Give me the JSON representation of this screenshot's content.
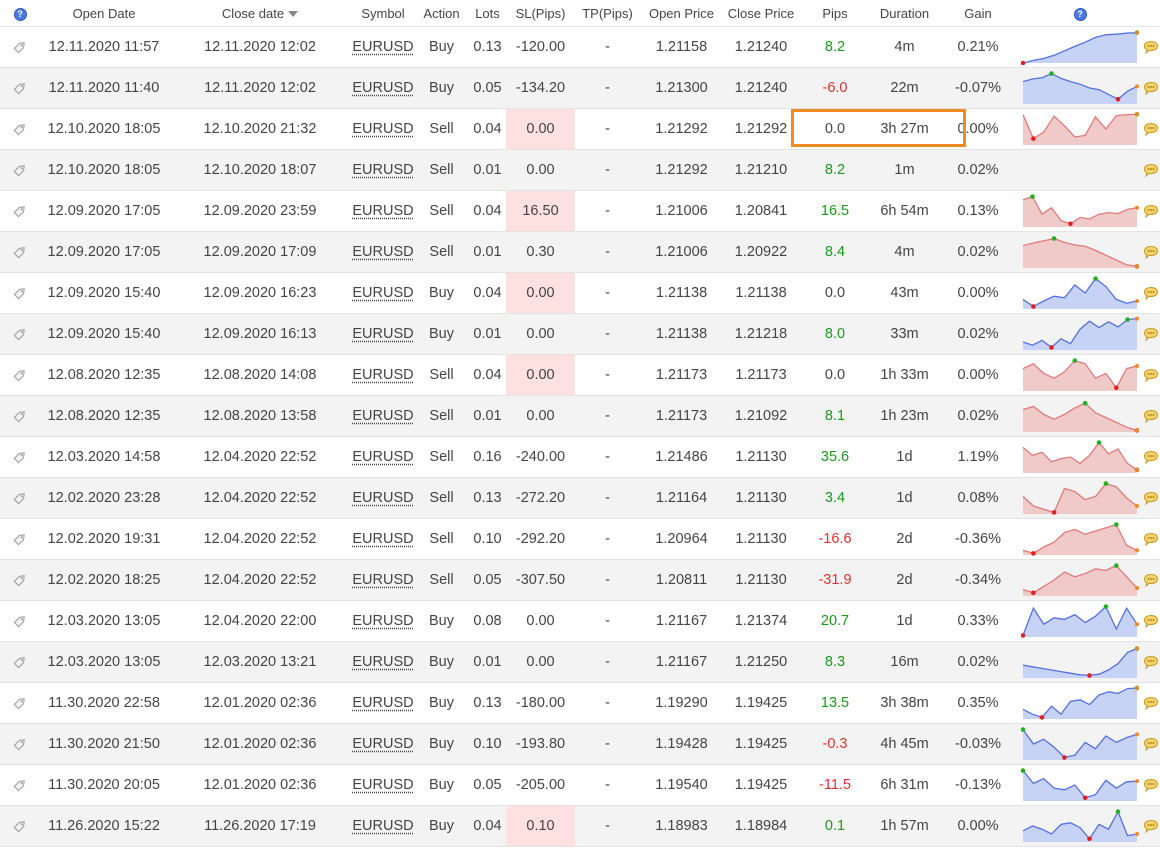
{
  "header": {
    "open_date": "Open Date",
    "close_date": "Close date",
    "symbol": "Symbol",
    "action": "Action",
    "lots": "Lots",
    "sl": "SL(Pips)",
    "tp": "TP(Pips)",
    "open_price": "Open Price",
    "close_price": "Close Price",
    "pips": "Pips",
    "duration": "Duration",
    "gain": "Gain",
    "help_glyph": "?"
  },
  "colors": {
    "buy_fill": "#c6d3f7",
    "buy_line": "#5570e0",
    "sell_fill": "#f0c9c9",
    "sell_line": "#e07a7a",
    "high_marker": "#22b022",
    "low_marker": "#e02020",
    "end_marker": "#f08a24",
    "highlight": "#f08a24"
  },
  "icons": {
    "row_tag": "tag-icon",
    "row_note": "comment-bubble-icon"
  },
  "rows": [
    {
      "open": "12.11.2020 11:57",
      "close": "12.11.2020 12:02",
      "symbol": "EURUSD",
      "action": "Buy",
      "lots": "0.13",
      "sl": "-120.00",
      "sl_pink": false,
      "tp": "-",
      "open_price": "1.21158",
      "close_price": "1.21240",
      "pips": "8.2",
      "duration": "4m",
      "gain": "0.21%",
      "spark": [
        0,
        8,
        14,
        24,
        38,
        52,
        65,
        80,
        88,
        90,
        93,
        95
      ],
      "spark_hi": 11,
      "spark_lo": 0
    },
    {
      "open": "12.11.2020 11:40",
      "close": "12.11.2020 12:02",
      "symbol": "EURUSD",
      "action": "Buy",
      "lots": "0.05",
      "sl": "-134.20",
      "sl_pink": false,
      "tp": "-",
      "open_price": "1.21300",
      "close_price": "1.21240",
      "pips": "-6.0",
      "duration": "22m",
      "gain": "-0.07%",
      "spark": [
        70,
        78,
        82,
        95,
        80,
        70,
        62,
        50,
        45,
        30,
        15,
        40,
        55
      ],
      "spark_hi": 3,
      "spark_lo": 10
    },
    {
      "open": "12.10.2020 18:05",
      "close": "12.10.2020 21:32",
      "symbol": "EURUSD",
      "action": "Sell",
      "lots": "0.04",
      "sl": "0.00",
      "sl_pink": true,
      "tp": "-",
      "open_price": "1.21292",
      "close_price": "1.21292",
      "pips": "0.0",
      "duration": "3h 27m",
      "gain": "0.00%",
      "spark": [
        95,
        20,
        40,
        90,
        60,
        25,
        30,
        88,
        50,
        92,
        95,
        96
      ],
      "spark_hi": 11,
      "spark_lo": 1
    },
    {
      "open": "12.10.2020 18:05",
      "close": "12.10.2020 18:07",
      "symbol": "EURUSD",
      "action": "Sell",
      "lots": "0.01",
      "sl": "0.00",
      "sl_pink": false,
      "tp": "-",
      "open_price": "1.21292",
      "close_price": "1.21210",
      "pips": "8.2",
      "duration": "1m",
      "gain": "0.02%",
      "spark": [],
      "spark_hi": -1,
      "spark_lo": -1
    },
    {
      "open": "12.09.2020 17:05",
      "close": "12.09.2020 23:59",
      "symbol": "EURUSD",
      "action": "Sell",
      "lots": "0.04",
      "sl": "16.50",
      "sl_pink": true,
      "tp": "-",
      "open_price": "1.21006",
      "close_price": "1.20841",
      "pips": "16.5",
      "duration": "6h 54m",
      "gain": "0.13%",
      "spark": [
        85,
        95,
        40,
        60,
        20,
        10,
        30,
        25,
        40,
        45,
        42,
        55,
        60
      ],
      "spark_hi": 1,
      "spark_lo": 5
    },
    {
      "open": "12.09.2020 17:05",
      "close": "12.09.2020 17:09",
      "symbol": "EURUSD",
      "action": "Sell",
      "lots": "0.01",
      "sl": "0.30",
      "sl_pink": false,
      "tp": "-",
      "open_price": "1.21006",
      "close_price": "1.20922",
      "pips": "8.4",
      "duration": "4m",
      "gain": "0.02%",
      "spark": [
        70,
        78,
        85,
        92,
        80,
        72,
        68,
        55,
        40,
        25,
        10,
        5
      ],
      "spark_hi": 3,
      "spark_lo": 11
    },
    {
      "open": "12.09.2020 15:40",
      "close": "12.09.2020 16:23",
      "symbol": "EURUSD",
      "action": "Buy",
      "lots": "0.04",
      "sl": "0.00",
      "sl_pink": true,
      "tp": "-",
      "open_price": "1.21138",
      "close_price": "1.21138",
      "pips": "0.0",
      "duration": "43m",
      "gain": "0.00%",
      "spark": [
        30,
        8,
        25,
        40,
        35,
        75,
        50,
        95,
        70,
        30,
        18,
        25
      ],
      "spark_hi": 7,
      "spark_lo": 1
    },
    {
      "open": "12.09.2020 15:40",
      "close": "12.09.2020 16:13",
      "symbol": "EURUSD",
      "action": "Buy",
      "lots": "0.01",
      "sl": "0.00",
      "sl_pink": false,
      "tp": "-",
      "open_price": "1.21138",
      "close_price": "1.21218",
      "pips": "8.0",
      "duration": "33m",
      "gain": "0.02%",
      "spark": [
        25,
        15,
        30,
        8,
        35,
        20,
        65,
        90,
        70,
        88,
        72,
        95,
        98
      ],
      "spark_hi": 11,
      "spark_lo": 3
    },
    {
      "open": "12.08.2020 12:35",
      "close": "12.08.2020 14:08",
      "symbol": "EURUSD",
      "action": "Sell",
      "lots": "0.04",
      "sl": "0.00",
      "sl_pink": true,
      "tp": "-",
      "open_price": "1.21173",
      "close_price": "1.21173",
      "pips": "0.0",
      "duration": "1h 33m",
      "gain": "0.00%",
      "spark": [
        70,
        85,
        55,
        40,
        60,
        95,
        85,
        40,
        55,
        10,
        70,
        78
      ],
      "spark_hi": 5,
      "spark_lo": 9
    },
    {
      "open": "12.08.2020 12:35",
      "close": "12.08.2020 13:58",
      "symbol": "EURUSD",
      "action": "Sell",
      "lots": "0.01",
      "sl": "0.00",
      "sl_pink": false,
      "tp": "-",
      "open_price": "1.21173",
      "close_price": "1.21092",
      "pips": "8.1",
      "duration": "1h 23m",
      "gain": "0.02%",
      "spark": [
        70,
        80,
        55,
        40,
        55,
        75,
        90,
        60,
        45,
        30,
        15,
        5
      ],
      "spark_hi": 6,
      "spark_lo": 11
    },
    {
      "open": "12.03.2020 14:58",
      "close": "12.04.2020 22:52",
      "symbol": "EURUSD",
      "action": "Sell",
      "lots": "0.16",
      "sl": "-240.00",
      "sl_pink": false,
      "tp": "-",
      "open_price": "1.21486",
      "close_price": "1.21130",
      "pips": "35.6",
      "duration": "1d",
      "gain": "1.19%",
      "spark": [
        80,
        55,
        65,
        35,
        45,
        50,
        30,
        55,
        95,
        60,
        75,
        30,
        10
      ],
      "spark_hi": 8,
      "spark_lo": 12
    },
    {
      "open": "12.02.2020 23:28",
      "close": "12.04.2020 22:52",
      "symbol": "EURUSD",
      "action": "Sell",
      "lots": "0.13",
      "sl": "-272.20",
      "sl_pink": false,
      "tp": "-",
      "open_price": "1.21164",
      "close_price": "1.21130",
      "pips": "3.4",
      "duration": "1d",
      "gain": "0.08%",
      "spark": [
        55,
        25,
        15,
        5,
        80,
        70,
        45,
        55,
        95,
        85,
        50,
        25
      ],
      "spark_hi": 8,
      "spark_lo": 3
    },
    {
      "open": "12.02.2020 19:31",
      "close": "12.04.2020 22:52",
      "symbol": "EURUSD",
      "action": "Sell",
      "lots": "0.10",
      "sl": "-292.20",
      "sl_pink": false,
      "tp": "-",
      "open_price": "1.20964",
      "close_price": "1.21130",
      "pips": "-16.6",
      "duration": "2d",
      "gain": "-0.36%",
      "spark": [
        15,
        5,
        25,
        40,
        70,
        80,
        65,
        75,
        85,
        95,
        30,
        15
      ],
      "spark_hi": 9,
      "spark_lo": 1
    },
    {
      "open": "12.02.2020 18:25",
      "close": "12.04.2020 22:52",
      "symbol": "EURUSD",
      "action": "Sell",
      "lots": "0.05",
      "sl": "-307.50",
      "sl_pink": false,
      "tp": "-",
      "open_price": "1.20811",
      "close_price": "1.21130",
      "pips": "-31.9",
      "duration": "2d",
      "gain": "-0.34%",
      "spark": [
        20,
        10,
        30,
        50,
        75,
        60,
        70,
        85,
        80,
        95,
        60,
        25
      ],
      "spark_hi": 9,
      "spark_lo": 1
    },
    {
      "open": "12.03.2020 13:05",
      "close": "12.04.2020 22:00",
      "symbol": "EURUSD",
      "action": "Buy",
      "lots": "0.08",
      "sl": "0.00",
      "sl_pink": false,
      "tp": "-",
      "open_price": "1.21167",
      "close_price": "1.21374",
      "pips": "20.7",
      "duration": "1d",
      "gain": "0.33%",
      "spark": [
        5,
        90,
        40,
        60,
        55,
        70,
        45,
        65,
        95,
        25,
        90,
        40
      ],
      "spark_hi": 8,
      "spark_lo": 0
    },
    {
      "open": "12.03.2020 13:05",
      "close": "12.03.2020 13:21",
      "symbol": "EURUSD",
      "action": "Buy",
      "lots": "0.01",
      "sl": "0.00",
      "sl_pink": false,
      "tp": "-",
      "open_price": "1.21167",
      "close_price": "1.21250",
      "pips": "8.3",
      "duration": "16m",
      "gain": "0.02%",
      "spark": [
        40,
        35,
        30,
        25,
        20,
        15,
        10,
        8,
        12,
        25,
        45,
        80,
        92
      ],
      "spark_hi": 12,
      "spark_lo": 7
    },
    {
      "open": "11.30.2020 22:58",
      "close": "12.01.2020 02:36",
      "symbol": "EURUSD",
      "action": "Buy",
      "lots": "0.13",
      "sl": "-180.00",
      "sl_pink": false,
      "tp": "-",
      "open_price": "1.19290",
      "close_price": "1.19425",
      "pips": "13.5",
      "duration": "3h 38m",
      "gain": "0.35%",
      "spark": [
        30,
        15,
        5,
        40,
        15,
        55,
        60,
        45,
        75,
        85,
        80,
        95,
        97
      ],
      "spark_hi": 12,
      "spark_lo": 2
    },
    {
      "open": "11.30.2020 21:50",
      "close": "12.01.2020 02:36",
      "symbol": "EURUSD",
      "action": "Buy",
      "lots": "0.10",
      "sl": "-193.80",
      "sl_pink": false,
      "tp": "-",
      "open_price": "1.19428",
      "close_price": "1.19425",
      "pips": "-0.3",
      "duration": "4h 45m",
      "gain": "-0.03%",
      "spark": [
        95,
        50,
        65,
        40,
        8,
        15,
        55,
        35,
        75,
        55,
        70,
        80
      ],
      "spark_hi": 0,
      "spark_lo": 4
    },
    {
      "open": "11.30.2020 20:05",
      "close": "12.01.2020 02:36",
      "symbol": "EURUSD",
      "action": "Buy",
      "lots": "0.05",
      "sl": "-205.00",
      "sl_pink": false,
      "tp": "-",
      "open_price": "1.19540",
      "close_price": "1.19425",
      "pips": "-11.5",
      "duration": "6h 31m",
      "gain": "-0.13%",
      "spark": [
        95,
        55,
        70,
        40,
        35,
        50,
        10,
        20,
        65,
        40,
        60,
        62
      ],
      "spark_hi": 0,
      "spark_lo": 6
    },
    {
      "open": "11.26.2020 15:22",
      "close": "11.26.2020 17:19",
      "symbol": "EURUSD",
      "action": "Buy",
      "lots": "0.04",
      "sl": "0.10",
      "sl_pink": true,
      "tp": "-",
      "open_price": "1.18983",
      "close_price": "1.18984",
      "pips": "0.1",
      "duration": "1h 57m",
      "gain": "0.00%",
      "spark": [
        35,
        50,
        40,
        25,
        55,
        60,
        45,
        10,
        55,
        40,
        95,
        20,
        25
      ],
      "spark_hi": 10,
      "spark_lo": 7
    }
  ]
}
